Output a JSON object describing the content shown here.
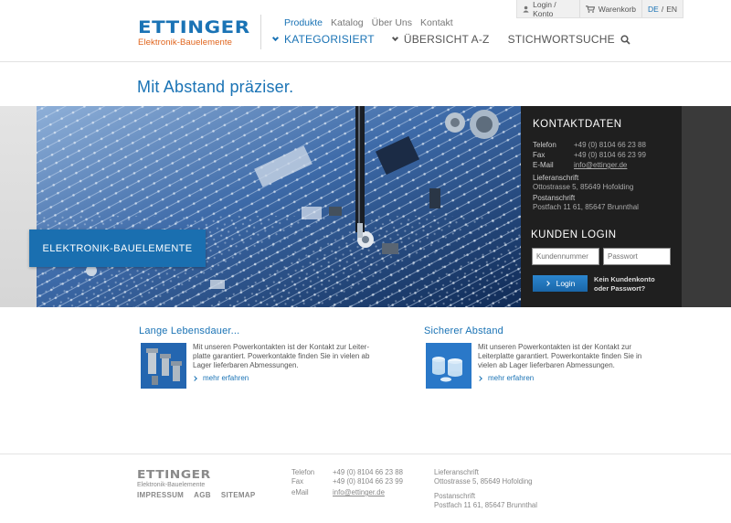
{
  "brand": {
    "name": "ETTINGER",
    "tagline": "Elektronik-Bauelemente"
  },
  "colors": {
    "accent": "#1a73b5",
    "logo_sub": "#e0641c",
    "panel": "#1f1f1f",
    "hero_label": "#1a6fb0"
  },
  "utility": {
    "login": "Login / Konto",
    "cart": "Warenkorb",
    "lang_de": "DE",
    "lang_sep": "/",
    "lang_en": "EN"
  },
  "topnav": [
    "Produkte",
    "Katalog",
    "Über Uns",
    "Kontakt"
  ],
  "mainnav": {
    "kategorisiert": "KATEGORISIERT",
    "uebersicht": "ÜBERSICHT A-Z",
    "stichwort": "STICHWORTSUCHE"
  },
  "page_title": "Mit Abstand präziser.",
  "hero": {
    "label": "ELEKTRONIK-BAUELEMENTE"
  },
  "contact": {
    "heading": "KONTAKTDATEN",
    "phone_label": "Telefon",
    "phone": "+49 (0) 8104 66 23 88",
    "fax_label": "Fax",
    "fax": "+49 (0) 8104 66 23 99",
    "email_label": "E-Mail",
    "email": "info@ettinger.de",
    "delivery_label": "Lieferanschrift",
    "delivery": "Ottostrasse 5, 85649 Hofolding",
    "postal_label": "Postanschrift",
    "postal": "Postfach 11 61, 85647 Brunnthal"
  },
  "login": {
    "heading": "KUNDEN LOGIN",
    "customer_placeholder": "Kundennummer",
    "password_placeholder": "Passwort",
    "button": "Login",
    "help_line1": "Kein Kundenkonto",
    "help_line2": "oder Passwort?"
  },
  "features": [
    {
      "title": "Lange Lebensdauer...",
      "text": "Mit unseren Powerkontakten ist der Kontakt zur Leiter-platte garantiert. Powerkontakte finden Sie in vielen ab Lager lieferbaren Abmessungen.",
      "more": "mehr erfahren",
      "thumb_icon": "standoff-bolts-image"
    },
    {
      "title": "Sicherer Abstand",
      "text": "Mit unseren Powerkontakten ist der Kontakt zur Leiterplatte garantiert. Powerkontakte finden Sie in vielen ab Lager lieferbaren Abmessungen.",
      "more": "mehr erfahren",
      "thumb_icon": "plastic-spacers-image"
    }
  ],
  "footer": {
    "brand": "ETTINGER",
    "tagline": "Elektronik-Bauelemente",
    "links": [
      "IMPRESSUM",
      "AGB",
      "SITEMAP"
    ],
    "phone_label": "Telefon",
    "phone": "+49 (0) 8104 66 23 88",
    "fax_label": "Fax",
    "fax": "+49 (0) 8104 66 23 99",
    "email_label": "eMail",
    "email": "info@ettinger.de",
    "delivery_label": "Lieferanschrift",
    "delivery": "Ottostrasse 5, 85649 Hofolding",
    "postal_label": "Postanschrift",
    "postal": "Postfach 11 61, 85647 Brunnthal"
  }
}
